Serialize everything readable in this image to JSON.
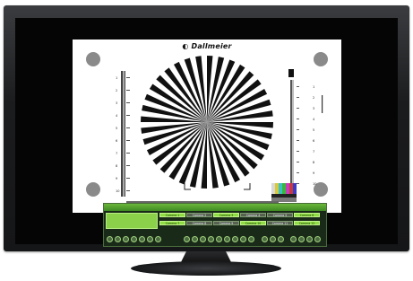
{
  "brand": {
    "logo_text": "Dallmeier"
  },
  "test_chart": {
    "left_scale": [
      "1",
      "2",
      "3",
      "4",
      "5",
      "6",
      "7",
      "8",
      "9",
      "10"
    ],
    "bottom_scale": [
      "1",
      "3",
      "5",
      "7",
      "9",
      "8",
      "6",
      "4",
      "2"
    ],
    "right_scale": [
      "1",
      "2",
      "3",
      "4",
      "5",
      "6",
      "7",
      "8",
      "9",
      "10"
    ]
  },
  "control_panel": {
    "cameras": [
      "Camera 1",
      "Camera 2",
      "Camera 3",
      "Camera 4",
      "Camera 5",
      "Camera 6",
      "Camera 7",
      "Camera 8",
      "Camera 9",
      "Camera 10",
      "Camera 11",
      "Camera 12"
    ],
    "active_cameras": [
      "Camera 1",
      "Camera 3",
      "Camera 6",
      "Camera 7",
      "Camera 10",
      "Camera 12"
    ]
  },
  "colors": {
    "panel_green": "#8fdc44",
    "panel_dark": "#1a2a18",
    "bezel": "#1b1c1e"
  }
}
